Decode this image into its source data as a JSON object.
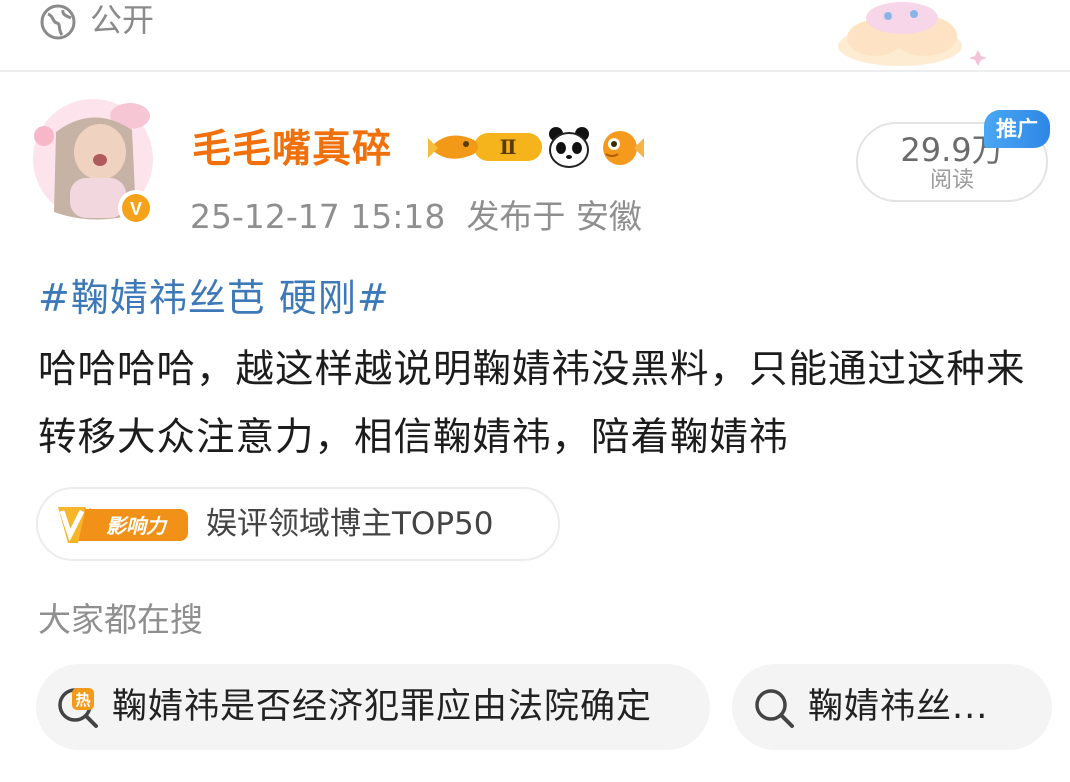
{
  "visibility": {
    "label": "公开",
    "icon": "globe-icon"
  },
  "author": {
    "name": "毛毛嘴真碎",
    "avatar_badge": "V",
    "badge_rank": "Ⅱ",
    "badges": [
      "fish-level-badge",
      "panda-icon",
      "pufferfish-icon"
    ]
  },
  "post": {
    "time": "25-12-17 15:18",
    "published_from": "发布于 安徽",
    "hashtag": "#鞠婧祎丝芭 硬刚#",
    "content": "哈哈哈哈，越这样越说明鞠婧祎没黑料，只能通过这种来转移大众注意力，相信鞠婧祎，陪着鞠婧祎"
  },
  "reads": {
    "count": "29.9万",
    "label": "阅读",
    "promo": "推广"
  },
  "influence": {
    "pill_label": "影响力",
    "pill_letter": "V",
    "text": "娱评领域博主TOP50"
  },
  "trending": {
    "title": "大家都在搜",
    "chips": [
      {
        "icon": "hot-search-icon",
        "hot_mark": "热",
        "text": "鞠婧祎是否经济犯罪应由法院确定"
      },
      {
        "icon": "search-icon",
        "text": "鞠婧祎丝..."
      }
    ]
  },
  "colors": {
    "username": "#f0710c",
    "hashtag": "#3d79b8",
    "promo": "#2f86e6",
    "influence": "#f08a0c"
  }
}
